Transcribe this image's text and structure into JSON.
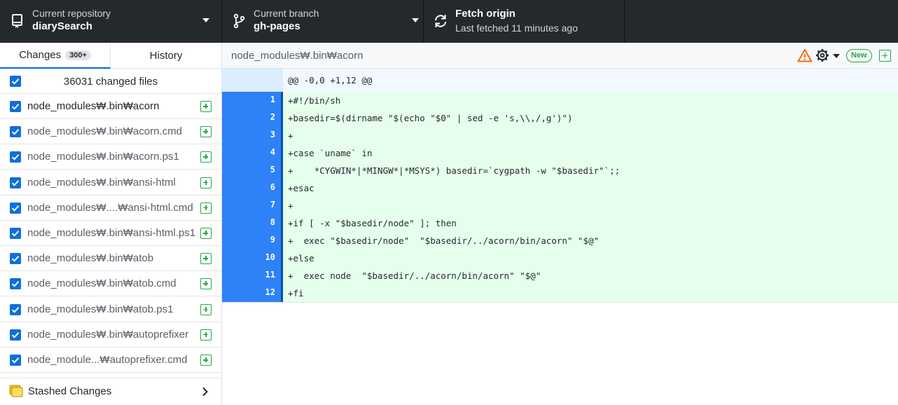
{
  "toolbar": {
    "repository": {
      "label": "Current repository",
      "value": "diarySearch"
    },
    "branch": {
      "label": "Current branch",
      "value": "gh-pages"
    },
    "fetch": {
      "label": "Fetch origin",
      "value": "Last fetched 11 minutes ago"
    }
  },
  "sidebar": {
    "tabs": [
      {
        "label": "Changes",
        "count": "300+"
      },
      {
        "label": "History"
      }
    ],
    "header": {
      "label": "36031 changed files"
    },
    "files": [
      {
        "name": "node_modules₩.bin₩acorn"
      },
      {
        "name": "node_modules₩.bin₩acorn.cmd"
      },
      {
        "name": "node_modules₩.bin₩acorn.ps1"
      },
      {
        "name": "node_modules₩.bin₩ansi-html"
      },
      {
        "name": "node_modules₩....₩ansi-html.cmd"
      },
      {
        "name": "node_modules₩.bin₩ansi-html.ps1"
      },
      {
        "name": "node_modules₩.bin₩atob"
      },
      {
        "name": "node_modules₩.bin₩atob.cmd"
      },
      {
        "name": "node_modules₩.bin₩atob.ps1"
      },
      {
        "name": "node_modules₩.bin₩autoprefixer"
      },
      {
        "name": "node_module...₩autoprefixer.cmd"
      }
    ],
    "stash": {
      "label": "Stashed Changes"
    }
  },
  "diff": {
    "path": "node_modules₩.bin₩acorn",
    "badge": "New",
    "hunk": "@@ -0,0 +1,12 @@",
    "lines": [
      {
        "num": "1",
        "text": "+#!/bin/sh"
      },
      {
        "num": "2",
        "text": "+basedir=$(dirname \"$(echo \"$0\" | sed -e 's,\\\\,/,g')\")"
      },
      {
        "num": "3",
        "text": "+"
      },
      {
        "num": "4",
        "text": "+case `uname` in"
      },
      {
        "num": "5",
        "text": "+    *CYGWIN*|*MINGW*|*MSYS*) basedir=`cygpath -w \"$basedir\"`;;"
      },
      {
        "num": "6",
        "text": "+esac"
      },
      {
        "num": "7",
        "text": "+"
      },
      {
        "num": "8",
        "text": "+if [ -x \"$basedir/node\" ]; then"
      },
      {
        "num": "9",
        "text": "+  exec \"$basedir/node\"  \"$basedir/../acorn/bin/acorn\" \"$@\""
      },
      {
        "num": "10",
        "text": "+else"
      },
      {
        "num": "11",
        "text": "+  exec node  \"$basedir/../acorn/bin/acorn\" \"$@\""
      },
      {
        "num": "12",
        "text": "+fi"
      }
    ]
  },
  "colors": {
    "toolbar_bg": "#24292e",
    "accent_blue": "#0366d6",
    "added_green": "#28a745",
    "added_line_bg": "#e6ffed",
    "gutter_selected": "#2f81f7",
    "warning": "#f66a0a"
  },
  "icons": {
    "repo": "repo-icon",
    "branch": "git-branch-icon",
    "fetch": "sync-icon",
    "warning": "alert-icon",
    "settings": "gear-icon",
    "added": "diff-added-icon",
    "stash": "stash-icon",
    "chevron": "chevron-right-icon"
  }
}
